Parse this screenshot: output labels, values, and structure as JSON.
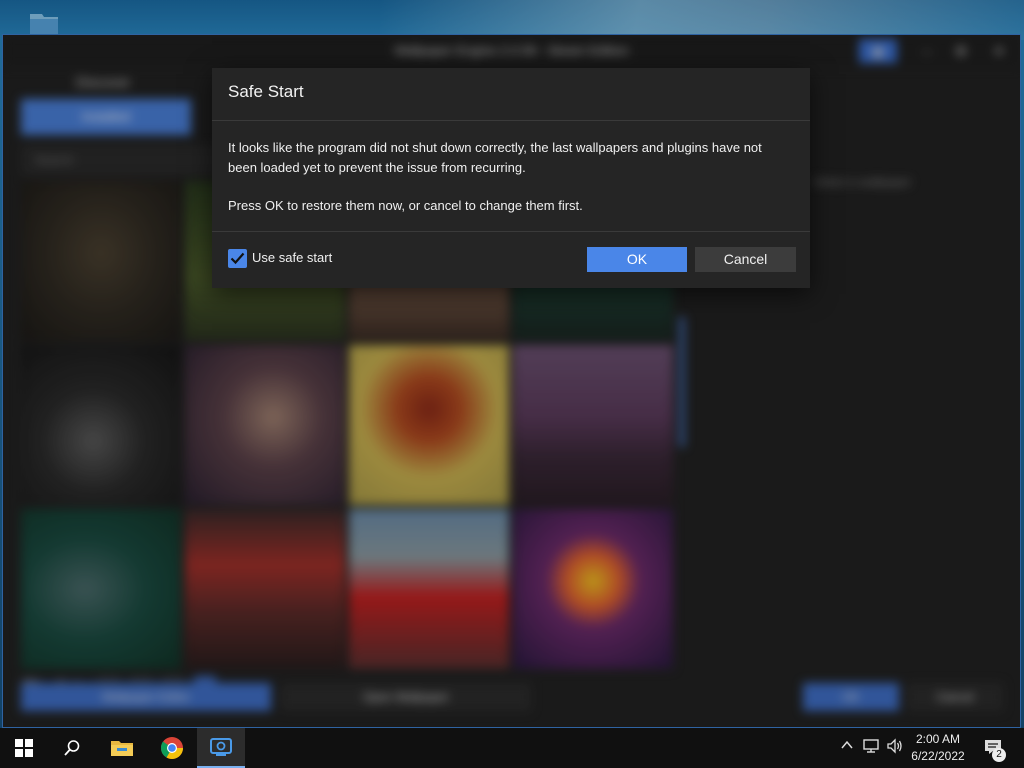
{
  "app": {
    "window_title": "Wallpaper Engine 2.0.58 - Steam Edition",
    "installed_tab": "Installed",
    "search_placeholder": "Search",
    "right_note": "Select a wallpaper",
    "playlist_label": "Playlist",
    "bottom": {
      "wallpaper_editor": "Wallpaper Editor",
      "open_wallpaper": "Open Wallpaper",
      "ok": "OK",
      "cancel": "Cancel"
    },
    "tiles": [
      {
        "name": "wallpaper-tile-1",
        "caption": ""
      },
      {
        "name": "wallpaper-tile-2",
        "caption": ""
      },
      {
        "name": "wallpaper-tile-3",
        "caption": ""
      },
      {
        "name": "wallpaper-tile-4",
        "caption": ""
      },
      {
        "name": "wallpaper-tile-5",
        "caption": ""
      },
      {
        "name": "wallpaper-tile-6",
        "caption": ""
      },
      {
        "name": "wallpaper-tile-7",
        "caption": ""
      },
      {
        "name": "wallpaper-tile-8",
        "caption": ""
      },
      {
        "name": "wallpaper-tile-9",
        "caption": ""
      },
      {
        "name": "wallpaper-tile-10",
        "caption": ""
      },
      {
        "name": "wallpaper-tile-11",
        "caption": ""
      },
      {
        "name": "wallpaper-tile-12",
        "caption": ""
      }
    ]
  },
  "dialog": {
    "title": "Safe Start",
    "message1": "It looks like the program did not shut down correctly, the last wallpapers and plugins have not been loaded yet to prevent the issue from recurring.",
    "message2": "Press OK to restore them now, or cancel to change them first.",
    "checkbox_label": "Use safe start",
    "checkbox_checked": true,
    "ok_label": "OK",
    "cancel_label": "Cancel",
    "accent": "#4a86e8"
  },
  "taskbar": {
    "items": [
      "start-icon",
      "search-icon",
      "file-explorer-icon",
      "chrome-icon",
      "wallpaper-engine-icon"
    ],
    "clock_time": "2:00 AM",
    "clock_date": "6/22/2022",
    "notification_count": "2"
  }
}
